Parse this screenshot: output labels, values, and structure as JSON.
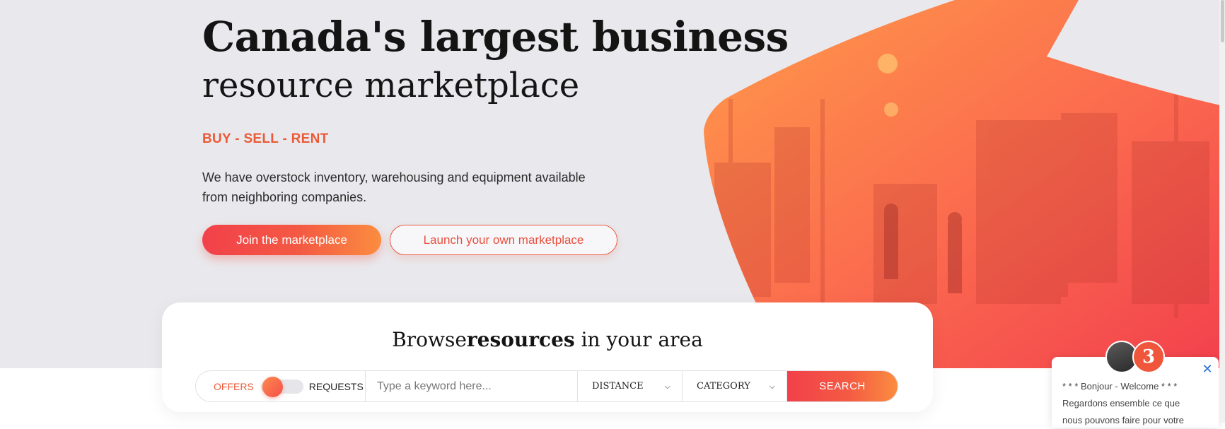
{
  "hero": {
    "headline_line1": "Canada's largest business",
    "headline_line2": "resource marketplace",
    "tagline": "BUY - SELL - RENT",
    "description": "We have overstock inventory, warehousing and equipment available from neighboring companies.",
    "join_button": "Join the marketplace",
    "launch_button": "Launch your own marketplace",
    "image_icon": "warehouse-photo"
  },
  "browse": {
    "title_prefix": "Browse",
    "title_bold": "resources",
    "title_suffix": " in your area",
    "toggle_left": "OFFERS",
    "toggle_right": "REQUESTS",
    "keyword_placeholder": "Type a keyword here...",
    "distance_label": "DISTANCE",
    "category_label": "CATEGORY",
    "search_button": "SEARCH"
  },
  "chat": {
    "brand_glyph": "3",
    "message_line1": "* * * Bonjour - Welcome * * *",
    "message_line2": "Regardons ensemble ce que",
    "message_line3": "nous pouvons faire pour votre",
    "close_icon": "close-icon"
  },
  "colors": {
    "accent": "#f2404a",
    "accent_orange": "#fb8d40",
    "tagline": "#ea5a37",
    "hero_bg": "#e9e9ed"
  }
}
